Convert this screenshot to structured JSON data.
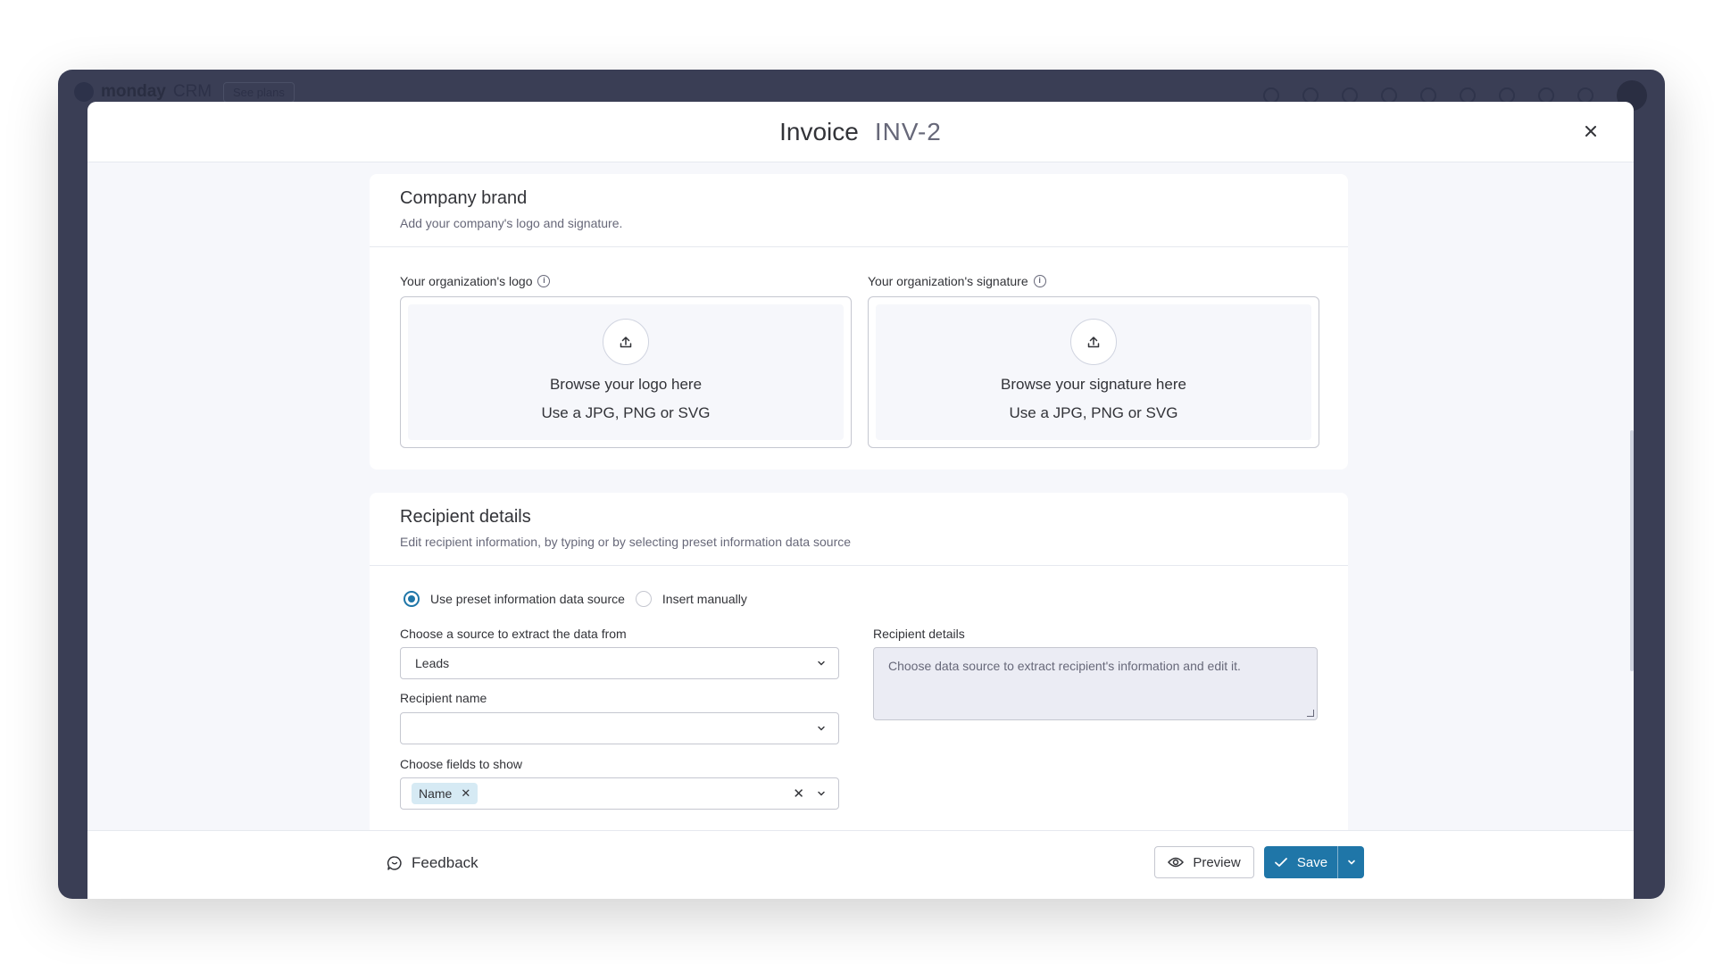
{
  "background": {
    "app_name": "monday",
    "app_sub": "CRM",
    "plans_label": "See plans"
  },
  "modal": {
    "title": "Invoice",
    "invoice_id": "INV-2"
  },
  "company_brand": {
    "title": "Company brand",
    "subtitle": "Add your company's logo and signature.",
    "logo": {
      "label": "Your organization's logo",
      "line1": "Browse your logo here",
      "line2": "Use a JPG, PNG or SVG"
    },
    "signature": {
      "label": "Your organization's signature",
      "line1": "Browse your signature here",
      "line2": "Use a JPG, PNG or SVG"
    }
  },
  "recipient": {
    "title": "Recipient details",
    "subtitle": "Edit recipient information, by typing or by selecting preset information data source",
    "radio_preset": "Use preset information data source",
    "radio_manual": "Insert manually",
    "source_label": "Choose a source to extract the data from",
    "source_value": "Leads",
    "name_label": "Recipient name",
    "name_value": "",
    "fields_label": "Choose fields to show",
    "fields_chip": "Name",
    "details_label": "Recipient details",
    "details_placeholder": "Choose data source to extract recipient's information and edit it."
  },
  "footer": {
    "feedback_label": "Feedback",
    "preview_label": "Preview",
    "save_label": "Save"
  },
  "colors": {
    "accent": "#1f76a8",
    "backdrop": "#3a3e55"
  }
}
